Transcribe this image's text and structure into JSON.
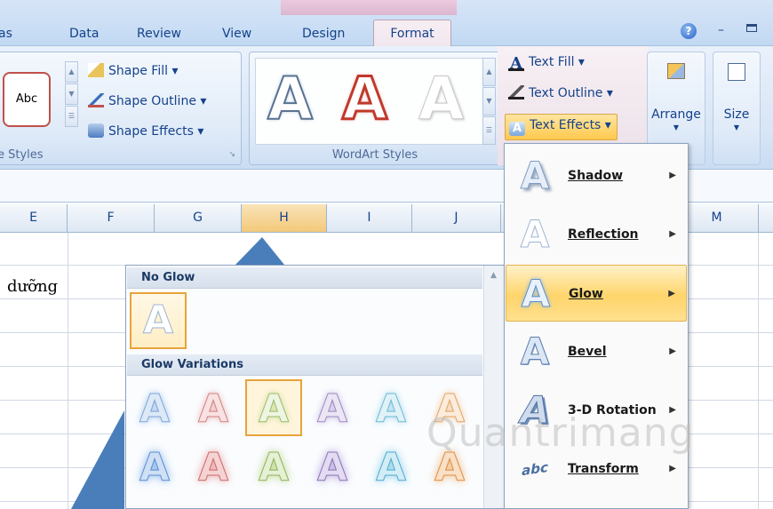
{
  "tabs": {
    "items": [
      "as",
      "Data",
      "Review",
      "View",
      "Design",
      "Format"
    ]
  },
  "window": {
    "help_glyph": "?",
    "minimize_glyph": "–"
  },
  "shape_styles": {
    "preview_label": "Abc",
    "shape_fill": "Shape Fill ▾",
    "shape_outline": "Shape Outline ▾",
    "shape_effects": "Shape Effects ▾",
    "group_label": "e Styles"
  },
  "wordart": {
    "gallery_letter": "A",
    "text_fill": "Text Fill ▾",
    "text_outline": "Text Outline ▾",
    "text_effects": "Text Effects ▾",
    "group_label": "WordArt Styles"
  },
  "arrange": {
    "label": "Arrange"
  },
  "size": {
    "label": "Size"
  },
  "columns": [
    "E",
    "F",
    "G",
    "H",
    "I",
    "J",
    "M"
  ],
  "cell_text": "dưỡng",
  "glow_panel": {
    "no_glow_header": "No Glow",
    "variations_header": "Glow Variations",
    "letter": "A"
  },
  "text_effects_menu": {
    "items": [
      {
        "label": "Shadow",
        "glyph": "A"
      },
      {
        "label": "Reflection",
        "glyph": "A"
      },
      {
        "label": "Glow",
        "glyph": "A"
      },
      {
        "label": "Bevel",
        "glyph": "A"
      },
      {
        "label": "3-D Rotation",
        "glyph": "A"
      },
      {
        "label": "Transform",
        "glyph": "abc"
      }
    ],
    "submenu_arrow": "▶"
  },
  "watermark": "Quantrimang",
  "colors": {
    "accent": "#15428b",
    "highlight": "#ffd56b",
    "format_tab": "#f1e6ee"
  }
}
